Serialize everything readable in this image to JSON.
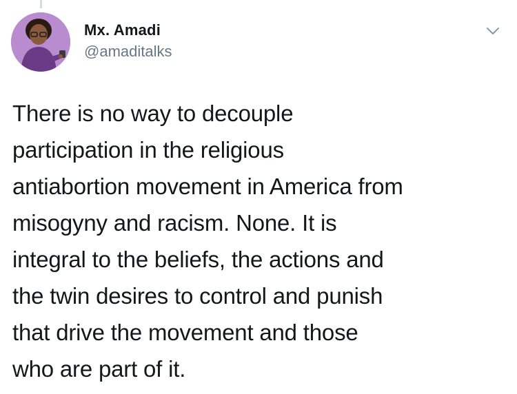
{
  "tweet": {
    "display_name": "Mx. Amadi",
    "handle": "@amaditalks",
    "lines": [
      "There is no way to decouple",
      "participation in the religious",
      "antiabortion movement in America from",
      "misogyny and racism. None. It is",
      "integral to the beliefs, the actions and",
      "the twin desires to control and punish",
      "that drive the movement and those",
      "who are part of it."
    ]
  },
  "icons": {
    "menu": "chevron-down-icon",
    "avatar": "avatar-illustration"
  },
  "colors": {
    "text": "#14171a",
    "handle": "#657786",
    "avatar_bg": "#b98cd0"
  }
}
